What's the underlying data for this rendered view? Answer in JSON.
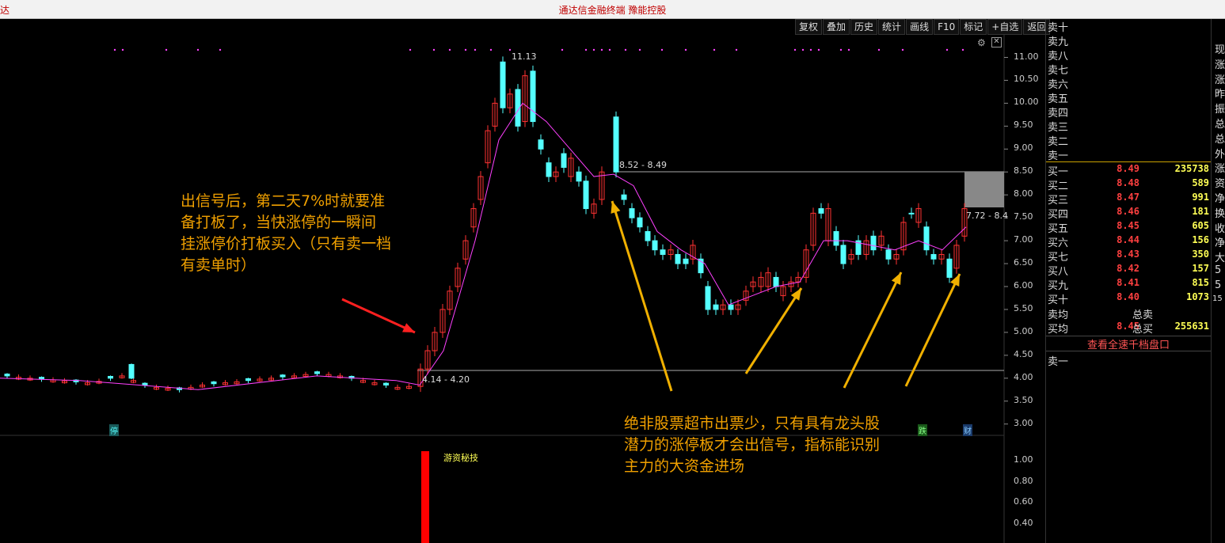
{
  "window": {
    "left_fragment": "达",
    "title": "通达信金融终端 豫能控股"
  },
  "toolbar": {
    "buttons": [
      "复权",
      "叠加",
      "历史",
      "统计",
      "画线",
      "F10",
      "标记",
      "+自选",
      "返回"
    ]
  },
  "controls": {
    "gear": "⚙",
    "close": "✕"
  },
  "price_axis": {
    "labels": [
      "11.00",
      "10.50",
      "10.00",
      "9.50",
      "9.00",
      "8.50",
      "8.00",
      "7.50",
      "7.00",
      "6.50",
      "6.00",
      "5.50",
      "5.00",
      "4.50",
      "4.00",
      "3.50",
      "3.00"
    ]
  },
  "indicator_axis": {
    "labels": [
      "1.00",
      "0.80",
      "0.60",
      "0.40"
    ]
  },
  "chart_labels": {
    "high": "11.13",
    "resistance": "8.52 - 8.49",
    "support": "4.14 - 4.20",
    "current": "7.72 - 8.4",
    "indicator_name": "游资秘技"
  },
  "markers": {
    "stop": "停",
    "die": "跌",
    "cai": "财"
  },
  "annotations": {
    "left": [
      "出信号后，第二天7%时就要准",
      "备打板了，当快涨停的一瞬间",
      "挂涨停价打板买入（只有卖一档",
      "有卖单时）"
    ],
    "bottom": [
      "绝非股票超市出票少，只有具有龙头股",
      "潜力的涨停板才会出信号，指标能识别",
      "主力的大资金进场"
    ]
  },
  "colors": {
    "up": "#ff3232",
    "down": "#54ffff",
    "ma": "#ff40ff",
    "annotation": "#f0a000",
    "signal": "#ff0000"
  },
  "order_book": {
    "sells": [
      {
        "label": "卖十"
      },
      {
        "label": "卖九"
      },
      {
        "label": "卖八"
      },
      {
        "label": "卖七"
      },
      {
        "label": "卖六"
      },
      {
        "label": "卖五"
      },
      {
        "label": "卖四"
      },
      {
        "label": "卖三"
      },
      {
        "label": "卖二"
      },
      {
        "label": "卖一"
      }
    ],
    "buys": [
      {
        "label": "买一",
        "price": "8.49",
        "vol": "235738"
      },
      {
        "label": "买二",
        "price": "8.48",
        "vol": "589"
      },
      {
        "label": "买三",
        "price": "8.47",
        "vol": "991"
      },
      {
        "label": "买四",
        "price": "8.46",
        "vol": "181"
      },
      {
        "label": "买五",
        "price": "8.45",
        "vol": "605"
      },
      {
        "label": "买六",
        "price": "8.44",
        "vol": "156"
      },
      {
        "label": "买七",
        "price": "8.43",
        "vol": "350"
      },
      {
        "label": "买八",
        "price": "8.42",
        "vol": "157"
      },
      {
        "label": "买九",
        "price": "8.41",
        "vol": "815"
      },
      {
        "label": "买十",
        "price": "8.40",
        "vol": "1073"
      }
    ],
    "sell_avg_label": "卖均",
    "buy_avg_label": "买均",
    "buy_avg_price": "8.45",
    "total_sell_label": "总卖",
    "total_buy_label": "总买",
    "total_buy": "255631",
    "full_book_link": "查看全速千档盘口",
    "sell1_label": "卖一"
  },
  "right_column": {
    "chars": [
      "现",
      "涨",
      "涨",
      "昨",
      "振",
      "总",
      "总",
      "外",
      "涨",
      "资",
      "净",
      "换",
      "收",
      "净",
      "大",
      "5",
      "5",
      "15"
    ]
  }
}
